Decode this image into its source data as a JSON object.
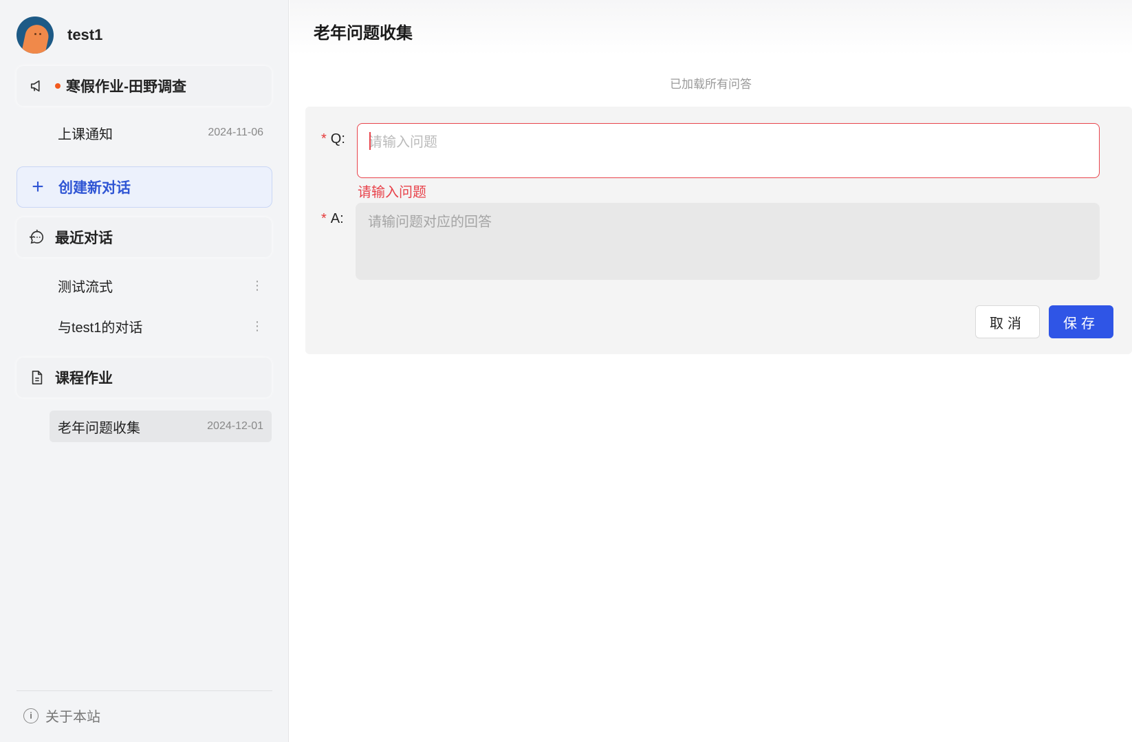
{
  "user": {
    "name": "test1"
  },
  "sidebar": {
    "announcement": {
      "label": "寒假作业-田野调查",
      "has_unread": true
    },
    "notice_items": [
      {
        "title": "上课通知",
        "date": "2024-11-06"
      }
    ],
    "new_chat_label": "创建新对话",
    "recent": {
      "label": "最近对话",
      "items": [
        {
          "title": "测试流式"
        },
        {
          "title": "与test1的对话"
        }
      ]
    },
    "homework": {
      "label": "课程作业",
      "items": [
        {
          "title": "老年问题收集",
          "date": "2024-12-01",
          "active": true
        }
      ]
    },
    "about_label": "关于本站"
  },
  "main": {
    "title": "老年问题收集",
    "loaded_note": "已加载所有问答",
    "form": {
      "required_mark": "*",
      "q_label": "Q:",
      "q_placeholder": "请输入问题",
      "q_error": "请输入问题",
      "a_label": "A:",
      "a_placeholder": "请输问题对应的回答",
      "cancel_label": "取消",
      "save_label": "保存"
    }
  },
  "colors": {
    "primary": "#2f55e6",
    "error": "#e8434b",
    "unread_dot": "#f25a1e",
    "sidebar_bg": "#f3f4f6"
  }
}
